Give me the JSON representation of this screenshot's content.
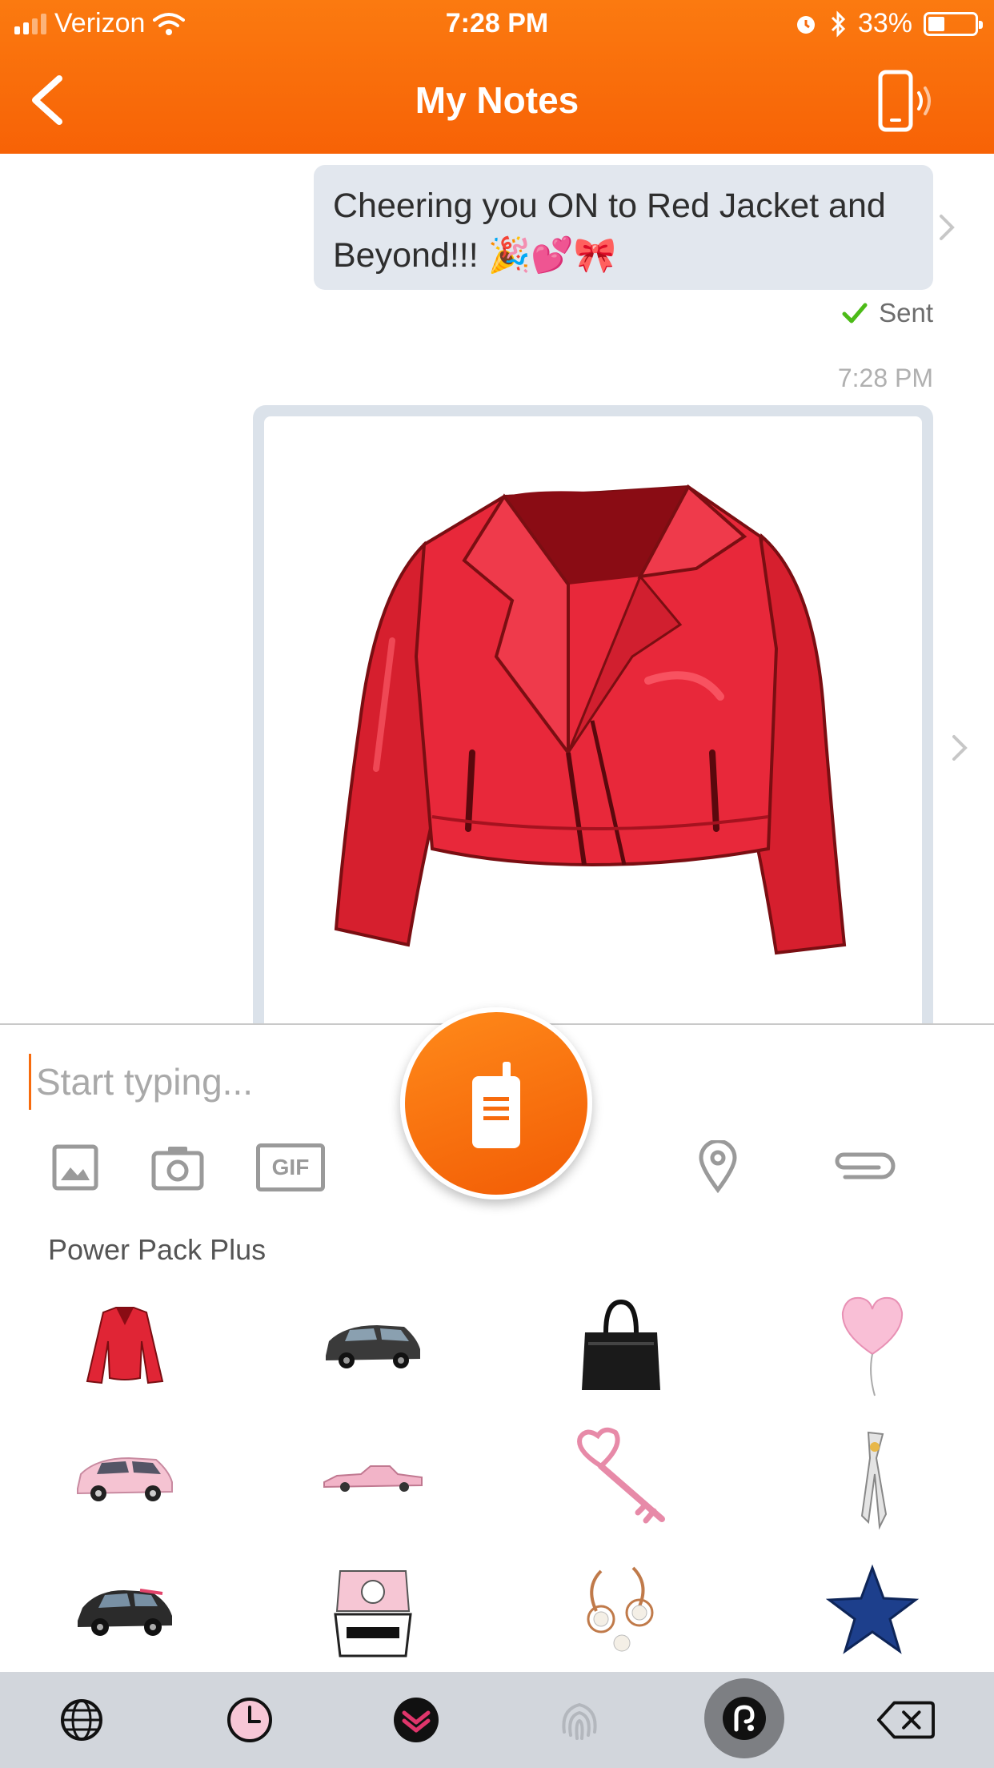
{
  "status_bar": {
    "carrier": "Verizon",
    "time": "7:28 PM",
    "battery": "33%",
    "battery_level": 0.33
  },
  "nav": {
    "title": "My Notes",
    "back_icon": "chevron-left-icon",
    "device_icon": "phone-signal-icon"
  },
  "messages": {
    "text": "Cheering you ON to Red Jacket and Beyond!!! 🎉💕🎀",
    "status": "Sent",
    "timestamp": "7:28 PM"
  },
  "composer": {
    "placeholder": "Start typing...",
    "tools": [
      "image-icon",
      "camera-icon",
      "gif-icon",
      "location-pin-icon",
      "paperclip-icon"
    ],
    "gif_label": "GIF"
  },
  "stickers": {
    "section_title": "Power Pack Plus",
    "items": [
      "red-jacket",
      "black-suv",
      "black-handbag",
      "pink-heart-balloon",
      "pink-suv",
      "pink-classic-car",
      "pink-heart-key",
      "ribbon-pin",
      "black-mini-car",
      "gift-box",
      "pearl-earrings",
      "blue-star"
    ]
  },
  "keyboard_bar": {
    "keys": [
      "globe-icon",
      "clock-icon",
      "sticker-pack-icon",
      "fingerprint-icon",
      "app-logo-icon",
      "backspace-icon"
    ]
  },
  "colors": {
    "accent": "#f76b0d",
    "bubble": "#e2e7ee",
    "sent_check": "#4cbb17"
  }
}
